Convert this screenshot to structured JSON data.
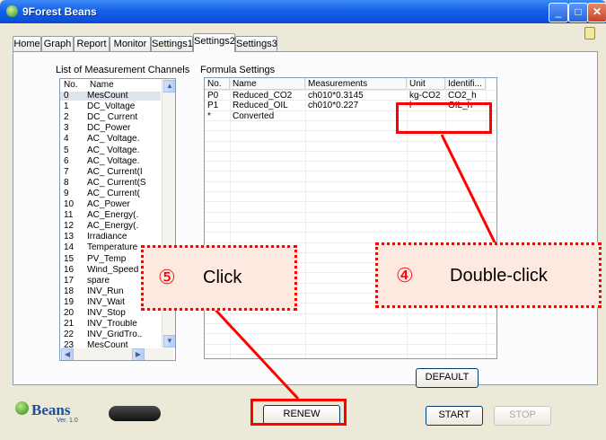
{
  "window": {
    "title": "9Forest Beans"
  },
  "tabs": [
    "Home",
    "Graph",
    "Report",
    "Monitor",
    "Settings1",
    "Settings2",
    "Settings3"
  ],
  "active_tab": "Settings2",
  "channels": {
    "label": "List of Measurement Channels",
    "header_no": "No.",
    "header_name": "Name",
    "rows": [
      {
        "no": "0",
        "name": "MesCount"
      },
      {
        "no": "1",
        "name": "DC_Voltage"
      },
      {
        "no": "2",
        "name": "DC_ Current"
      },
      {
        "no": "3",
        "name": "DC_Power"
      },
      {
        "no": "4",
        "name": "AC_ Voltage."
      },
      {
        "no": "5",
        "name": "AC_ Voltage."
      },
      {
        "no": "6",
        "name": "AC_ Voltage."
      },
      {
        "no": "7",
        "name": "AC_ Current(I"
      },
      {
        "no": "8",
        "name": "AC_ Current(S"
      },
      {
        "no": "9",
        "name": "AC_ Current("
      },
      {
        "no": "10",
        "name": "AC_Power"
      },
      {
        "no": "11",
        "name": "AC_Energy(."
      },
      {
        "no": "12",
        "name": "AC_Energy(."
      },
      {
        "no": "13",
        "name": "Irradiance"
      },
      {
        "no": "14",
        "name": "Temperature"
      },
      {
        "no": "15",
        "name": "PV_Temp"
      },
      {
        "no": "16",
        "name": "Wind_Speed"
      },
      {
        "no": "17",
        "name": "spare"
      },
      {
        "no": "18",
        "name": "INV_Run"
      },
      {
        "no": "19",
        "name": "INV_Wait"
      },
      {
        "no": "20",
        "name": "INV_Stop"
      },
      {
        "no": "21",
        "name": "INV_Trouble"
      },
      {
        "no": "22",
        "name": "INV_GridTro.."
      },
      {
        "no": "23",
        "name": "MesCount"
      }
    ]
  },
  "formula": {
    "label": "Formula Settings",
    "headers": [
      "No.",
      "Name",
      "Measurements",
      "Unit",
      "Identifi..."
    ],
    "rows": [
      {
        "no": "P0",
        "name": "Reduced_CO2",
        "meas": "ch010*0.3145",
        "unit": "kg-CO2",
        "id": "CO2_h"
      },
      {
        "no": "P1",
        "name": "Reduced_OIL",
        "meas": "ch010*0.227",
        "unit": "l",
        "id": "OIL_h"
      },
      {
        "no": "*",
        "name": "Converted",
        "meas": "",
        "unit": "",
        "id": ""
      }
    ]
  },
  "buttons": {
    "default": "DEFAULT",
    "renew": "RENEW",
    "start": "START",
    "stop": "STOP"
  },
  "logo": {
    "text": "Beans",
    "version": "Ver. 1.0"
  },
  "callouts": {
    "click": {
      "num": "⑤",
      "text": "Click"
    },
    "dbl": {
      "num": "④",
      "text": "Double-click"
    }
  },
  "colors": {
    "annotation": "#ff0000",
    "callout_bg": "#fde9e0",
    "titlebar": "#1561e8"
  }
}
